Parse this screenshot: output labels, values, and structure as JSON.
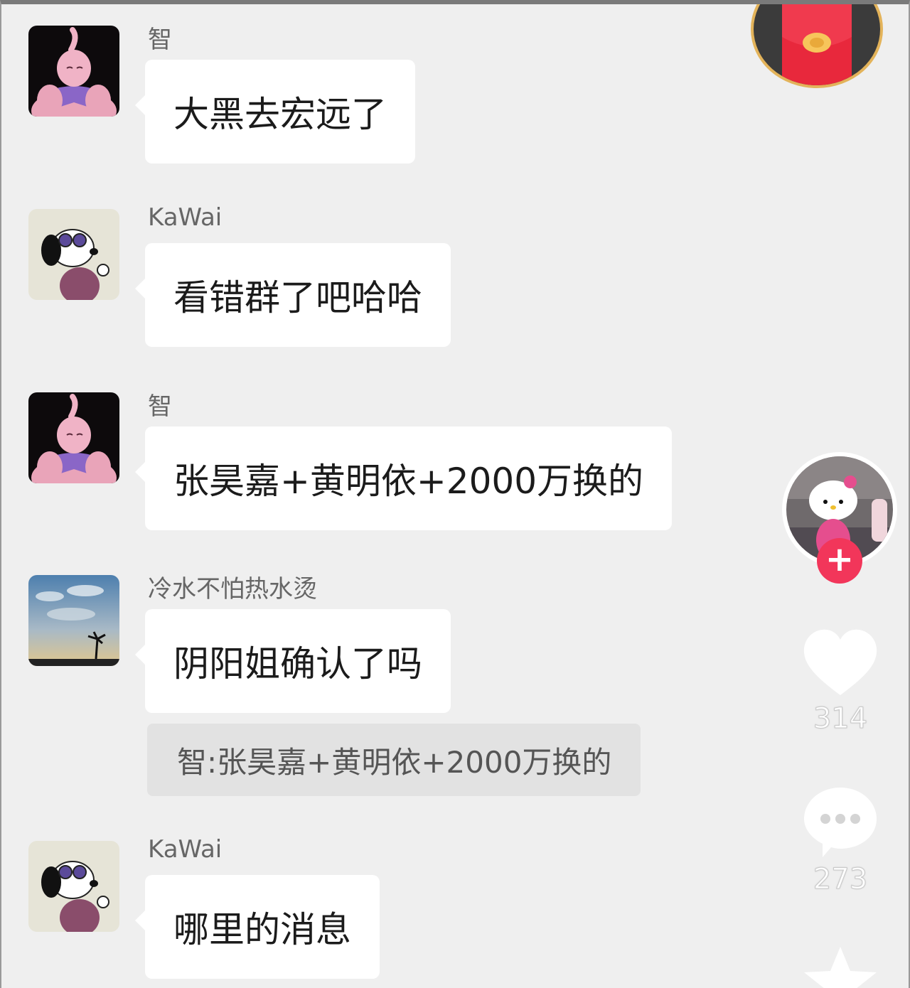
{
  "messages": [
    {
      "sender": "智",
      "text": "大黑去宏远了",
      "avatar": "majin-buu-avatar"
    },
    {
      "sender": "KaWai",
      "text": "看错群了吧哈哈",
      "avatar": "snoopy-avatar"
    },
    {
      "sender": "智",
      "text": "张昊嘉+黄明依+2000万换的",
      "avatar": "majin-buu-avatar"
    },
    {
      "sender": "冷水不怕热水烫",
      "text": "阴阳姐确认了吗",
      "avatar": "sky-avatar",
      "quote": "智:张昊嘉+黄明依+2000万换的"
    },
    {
      "sender": "KaWai",
      "text": "哪里的消息",
      "avatar": "snoopy-avatar"
    }
  ],
  "sidebar": {
    "follow_label": "+",
    "likes": "314",
    "comments": "273"
  },
  "icons": {
    "red_packet": "red-packet-icon",
    "creator": "hello-kitty-avatar",
    "like": "heart-icon",
    "comment": "comment-icon",
    "favorite": "star-icon"
  },
  "colors": {
    "background": "#efefef",
    "bubble": "#ffffff",
    "quote_bg": "#e2e2e2",
    "follow": "#f2365a",
    "red_packet_ring": "#e3b35a"
  }
}
